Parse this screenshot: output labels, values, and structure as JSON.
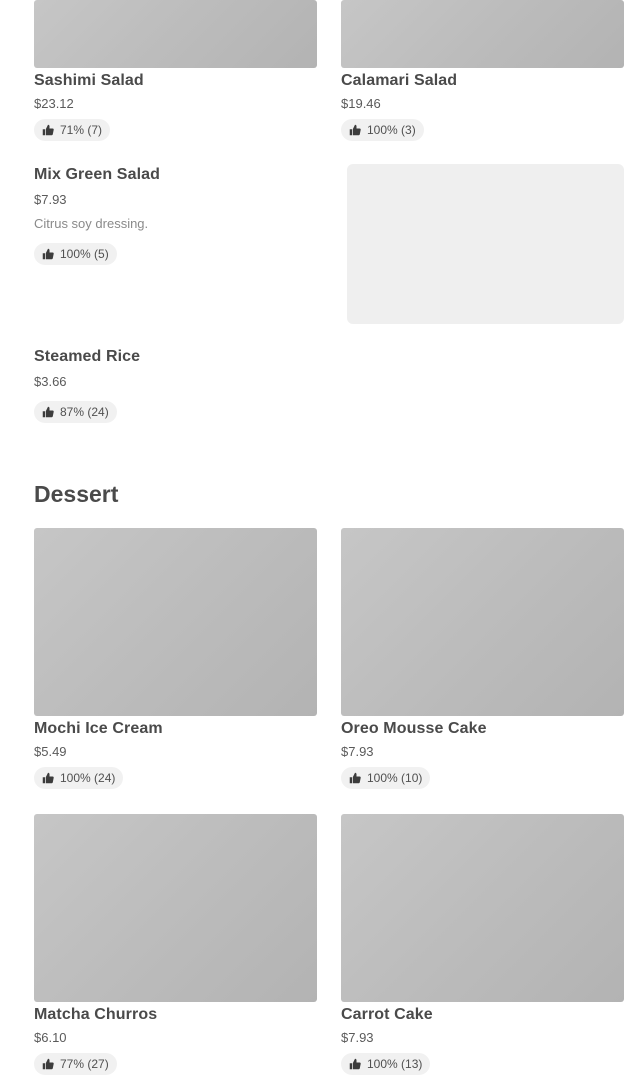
{
  "items_top": [
    {
      "name": "Sashimi Salad",
      "price": "$23.12",
      "rating": "71% (7)"
    },
    {
      "name": "Calamari Salad",
      "price": "$19.46",
      "rating": "100% (3)"
    },
    {
      "name": "Mix Green Salad",
      "price": "$7.93",
      "description": "Citrus soy dressing.",
      "rating": "100% (5)"
    },
    {
      "name": "Steamed Rice",
      "price": "$3.66",
      "rating": "87% (24)"
    }
  ],
  "dessert": {
    "title": "Dessert",
    "items": [
      {
        "name": "Mochi Ice Cream",
        "price": "$5.49",
        "rating": "100% (24)"
      },
      {
        "name": "Oreo Mousse Cake",
        "price": "$7.93",
        "rating": "100% (10)"
      },
      {
        "name": "Matcha Churros",
        "price": "$6.10",
        "rating": "77% (27)"
      },
      {
        "name": "Carrot Cake",
        "price": "$7.93",
        "rating": "100% (13)"
      }
    ]
  },
  "icons": {
    "rating": "thumbs-up-icon"
  }
}
